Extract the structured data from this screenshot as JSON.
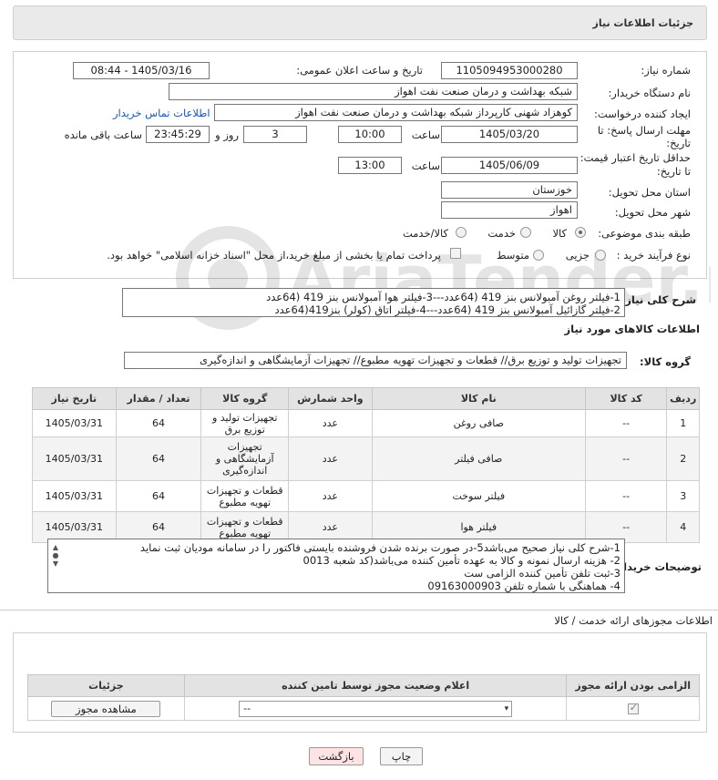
{
  "header": {
    "title": "جزئیات اطلاعات نیاز"
  },
  "form": {
    "need_number": {
      "label": "شماره نیاز:",
      "value": "1105094953000280"
    },
    "announce": {
      "label": "تاریخ و ساعت اعلان عمومی:",
      "value": "1405/03/16 - 08:44"
    },
    "buyer_org": {
      "label": "نام دستگاه خریدار:",
      "value": "شبکه بهداشت و درمان صنعت نفت اهواز"
    },
    "requester": {
      "label": "ایجاد کننده درخواست:",
      "value": "کوهزاد شهنی کارپرداز شبکه بهداشت و درمان صنعت نفت اهواز"
    },
    "buyer_contact_link": "اطلاعات تماس خریدار",
    "send_deadline": {
      "label_line1": "مهلت ارسال پاسخ: تا",
      "label_line2": "تاریخ:",
      "date": "1405/03/20",
      "time_label": "ساعت",
      "time": "10:00",
      "days": "3",
      "days_label": "روز و",
      "remaining": "23:45:29",
      "remaining_label": "ساعت باقی مانده"
    },
    "price_validity": {
      "label_line1": "حداقل تاریخ اعتبار قیمت:",
      "label_line2": "تا تاریخ:",
      "date": "1405/06/09",
      "time_label": "ساعت",
      "time": "13:00"
    },
    "province": {
      "label": "استان محل تحویل:",
      "value": "خوزستان"
    },
    "city": {
      "label": "شهر محل تحویل:",
      "value": "اهواز"
    },
    "category": {
      "label": "طبقه بندی موضوعی:",
      "options": [
        "کالا",
        "خدمت",
        "کالا/خدمت"
      ],
      "selected": "کالا"
    },
    "process": {
      "label": "نوع فرآیند خرید :",
      "options": [
        "جزیی",
        "متوسط"
      ],
      "selected": "",
      "payment_note": "پرداخت تمام یا بخشی از مبلغ خرید،از محل \"اسناد خزانه اسلامی\" خواهد بود."
    }
  },
  "summary": {
    "label": "شرح کلی نیاز:",
    "lines": [
      "1-فیلتر روغن آمبولانس بنز 419 (64عدد---3-فیلتر هوا آمبولانس بنز 419 (64عدد",
      "2-فیلتر گازائیل آمبولانس بنز 419 (64عدد---4-فیلتر اتاق (کولر) بنز419(64عدد"
    ]
  },
  "goods": {
    "section_title": "اطلاعات کالاهای مورد نیاز",
    "group_label": "گروه کالا:",
    "group_value": "تجهیزات تولید و توزیع برق//  قطعات و تجهیزات تهویه مطبوع// تجهیزات آزمایشگاهی و اندازه‌گیری",
    "columns": [
      "ردیف",
      "کد کالا",
      "نام کالا",
      "واحد شمارش",
      "گروه کالا",
      "تعداد / مقدار",
      "تاریخ نیاز"
    ],
    "rows": [
      [
        "1",
        "--",
        "صافی روغن",
        "عدد",
        "تجهیزات تولید و توزیع برق",
        "64",
        "1405/03/31"
      ],
      [
        "2",
        "--",
        "صافی فیلتر",
        "عدد",
        "تجهیزات آزمایشگاهی و اندازه‌گیری",
        "64",
        "1405/03/31"
      ],
      [
        "3",
        "--",
        "فیلتر سوخت",
        "عدد",
        "قطعات و تجهیزات تهویه مطبوع",
        "64",
        "1405/03/31"
      ],
      [
        "4",
        "--",
        "فیلتر هوا",
        "عدد",
        "قطعات و تجهیزات تهویه مطبوع",
        "64",
        "1405/03/31"
      ]
    ]
  },
  "buyer_notes": {
    "label": "توضیحات خریدار:",
    "lines": [
      "1-شرح کلی نیاز صحیح می‌باشد5-در صورت برنده شدن فروشنده بایستی فاکتور را در سامانه مودیان ثبت نماید",
      "2- هزینه ارسال نمونه و کالا به عهده تأمین کننده می‌باشد(کد شعبه 0013",
      "3-ثبت تلفن تأمین کننده الزامی ست",
      "4- هماهنگی با شماره تلفن 09163000903"
    ]
  },
  "permits": {
    "section_title": "اطلاعات مجوزهای ارائه خدمت / کالا",
    "columns": [
      "الزامی بودن ارائه مجوز",
      "اعلام وضعیت مجوز توسط تامین کننده",
      "جزئیات"
    ],
    "select_value": "--",
    "view_button": "مشاهده مجوز"
  },
  "actions": {
    "print": "چاپ",
    "back": "بازگشت"
  },
  "watermark": {
    "text": "AriaTender.neT"
  }
}
